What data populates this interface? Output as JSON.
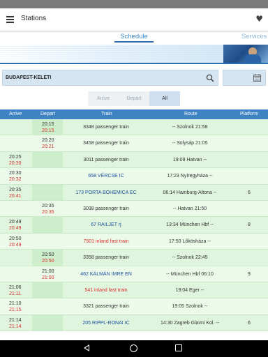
{
  "app": {
    "title": "Stations"
  },
  "tabs": {
    "schedule": "Schedule",
    "services": "Services"
  },
  "search": {
    "value": "BUDAPEST-KELETI"
  },
  "toggle": {
    "arrive": "Arrive",
    "depart": "Depart",
    "all": "All",
    "selected": "All"
  },
  "table": {
    "headers": {
      "arrive": "Arrive",
      "depart": "Depart",
      "train": "Train",
      "route": "Route",
      "platform": "Platform"
    },
    "rows": [
      {
        "arrive_sched": "",
        "arrive_actual": "",
        "depart_sched": "20:15",
        "depart_actual": "20:15",
        "train": "3348 passenger train",
        "train_style": "normal",
        "route": "-- Szolnok 21:58",
        "platform": ""
      },
      {
        "arrive_sched": "",
        "arrive_actual": "",
        "depart_sched": "20:20",
        "depart_actual": "20:21",
        "train": "3458 passenger train",
        "train_style": "normal",
        "route": "-- Sülysáp 21:05",
        "platform": ""
      },
      {
        "arrive_sched": "20:25",
        "arrive_actual": "20:30",
        "depart_sched": "",
        "depart_actual": "",
        "train": "3011 passenger train",
        "train_style": "normal",
        "route": "19:09 Hatvan --",
        "platform": ""
      },
      {
        "arrive_sched": "20:30",
        "arrive_actual": "20:32",
        "depart_sched": "",
        "depart_actual": "",
        "train": "658 VÉRCSE IC",
        "train_style": "ic",
        "route": "17:23 Nyíregyháza --",
        "platform": ""
      },
      {
        "arrive_sched": "20:35",
        "arrive_actual": "20:41",
        "depart_sched": "",
        "depart_actual": "",
        "train": "173 PORTA BOHEMICA EC",
        "train_style": "ic",
        "route": "06:14 Hamburg-Altona --",
        "platform": "6"
      },
      {
        "arrive_sched": "",
        "arrive_actual": "",
        "depart_sched": "20:35",
        "depart_actual": "20:35",
        "train": "3038 passenger train",
        "train_style": "normal",
        "route": "-- Hatvan 21:50",
        "platform": ""
      },
      {
        "arrive_sched": "20:49",
        "arrive_actual": "20:49",
        "depart_sched": "",
        "depart_actual": "",
        "train": "67 RAILJET rj",
        "train_style": "ic",
        "route": "13:34 München Hbf --",
        "platform": "8"
      },
      {
        "arrive_sched": "20:50",
        "arrive_actual": "20:49",
        "depart_sched": "",
        "depart_actual": "",
        "train": "7501 inland fast train",
        "train_style": "red",
        "route": "17:50 Lőkösháza --",
        "platform": ""
      },
      {
        "arrive_sched": "",
        "arrive_actual": "",
        "depart_sched": "20:50",
        "depart_actual": "20:50",
        "train": "3358 passenger train",
        "train_style": "normal",
        "route": "-- Szolnok 22:45",
        "platform": ""
      },
      {
        "arrive_sched": "",
        "arrive_actual": "",
        "depart_sched": "21:00",
        "depart_actual": "21:00",
        "train": "462 KÁLMÁN IMRE EN",
        "train_style": "ic",
        "route": "-- München Hbf 06:10",
        "platform": "9"
      },
      {
        "arrive_sched": "21:06",
        "arrive_actual": "21:11",
        "depart_sched": "",
        "depart_actual": "",
        "train": "541 inland fast train",
        "train_style": "red",
        "route": "19:04 Eger --",
        "platform": ""
      },
      {
        "arrive_sched": "21:10",
        "arrive_actual": "21:15",
        "depart_sched": "",
        "depart_actual": "",
        "train": "3321 passenger train",
        "train_style": "normal",
        "route": "19:05 Szolnok --",
        "platform": ""
      },
      {
        "arrive_sched": "21:14",
        "arrive_actual": "21:14",
        "depart_sched": "",
        "depart_actual": "",
        "train": "205 RIPPL-RONAI IC",
        "train_style": "ic",
        "route": "14:30 Zagreb Glavni Kol. --",
        "platform": "6"
      }
    ]
  },
  "colors": {
    "accent": "#3f83c4",
    "delay": "#d9302c",
    "ic_train": "#1a4e9e",
    "row_bg": "#dff5dd"
  },
  "icons": {
    "menu": "hamburger-menu-icon",
    "favorite": "heart-icon",
    "search": "search-icon",
    "calendar": "calendar-icon",
    "nav": [
      "back-icon",
      "home-icon",
      "recent-apps-icon"
    ]
  }
}
